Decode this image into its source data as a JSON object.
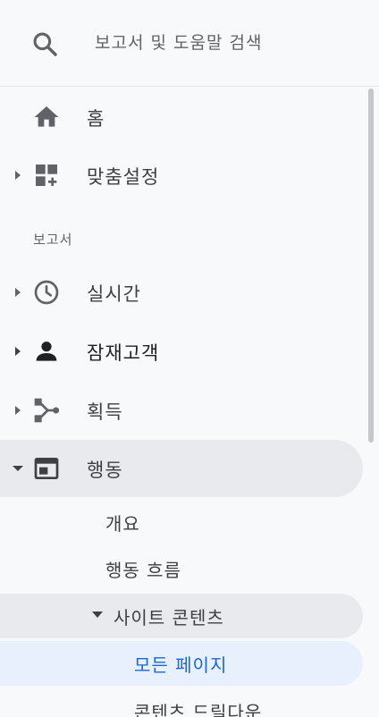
{
  "search": {
    "placeholder": "보고서 및 도움말 검색",
    "icon": "search-icon"
  },
  "nav": {
    "items": [
      {
        "label": "홈",
        "icon": "home-icon"
      },
      {
        "label": "맞춤설정",
        "icon": "dashboard-add-icon"
      },
      {
        "label": "실시간",
        "icon": "clock-icon"
      },
      {
        "label": "잠재고객",
        "icon": "person-icon"
      },
      {
        "label": "획득",
        "icon": "acquisition-icon"
      },
      {
        "label": "행동",
        "icon": "behavior-icon"
      }
    ],
    "section_label": "보고서",
    "behavior_children": [
      {
        "label": "개요"
      },
      {
        "label": "행동 흐름"
      },
      {
        "label": "사이트 콘텐츠"
      },
      {
        "label": "모든 페이지"
      },
      {
        "label": "콘텐츠 드릴다운"
      }
    ]
  },
  "colors": {
    "background": "#f8f9fa",
    "selected": "#e8eaed",
    "active_bg": "#e8f0fe",
    "active_text": "#1967d2",
    "icon": "#5f6368"
  }
}
